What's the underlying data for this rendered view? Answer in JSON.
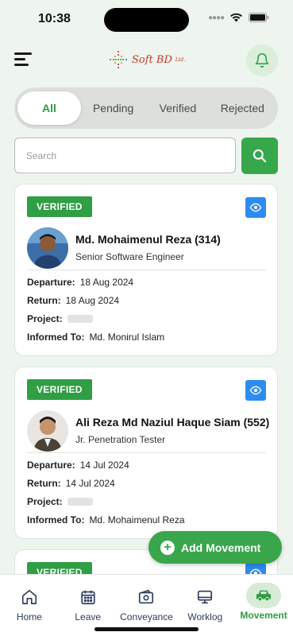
{
  "status_bar": {
    "time": "10:38"
  },
  "header": {
    "logo_text": "Soft BD",
    "logo_suffix": "Ltd."
  },
  "tabs": [
    {
      "label": "All",
      "active": true
    },
    {
      "label": "Pending",
      "active": false
    },
    {
      "label": "Verified",
      "active": false
    },
    {
      "label": "Rejected",
      "active": false
    }
  ],
  "search": {
    "placeholder": "Search",
    "value": ""
  },
  "labels": {
    "departure": "Departure:",
    "return": "Return:",
    "project": "Project:",
    "informed_to": "Informed To:"
  },
  "cards": [
    {
      "status": "VERIFIED",
      "name": "Md. Mohaimenul Reza (314)",
      "role": "Senior Software Engineer",
      "departure": "18 Aug 2024",
      "return": "18 Aug 2024",
      "informed_to": "Md. Monirul Islam"
    },
    {
      "status": "VERIFIED",
      "name": "Ali Reza Md Naziul Haque Siam (552)",
      "role": "Jr. Penetration Tester",
      "departure": "14 Jul 2024",
      "return": "14 Jul 2024",
      "informed_to": "Md. Mohaimenul Reza"
    },
    {
      "status": "VERIFIED"
    }
  ],
  "fab": {
    "label": "Add Movement"
  },
  "bottom_nav": [
    {
      "label": "Home",
      "icon": "home-icon",
      "active": false
    },
    {
      "label": "Leave",
      "icon": "calendar-icon",
      "active": false
    },
    {
      "label": "Conveyance",
      "icon": "wallet-icon",
      "active": false
    },
    {
      "label": "Worklog",
      "icon": "monitor-icon",
      "active": false
    },
    {
      "label": "Movement",
      "icon": "car-icon",
      "active": true
    }
  ],
  "colors": {
    "primary": "#36a74a",
    "background": "#eef4ee",
    "badge": "#2f9e44",
    "eye_button": "#2d8cf0",
    "nav_text": "#2d3a5f"
  }
}
